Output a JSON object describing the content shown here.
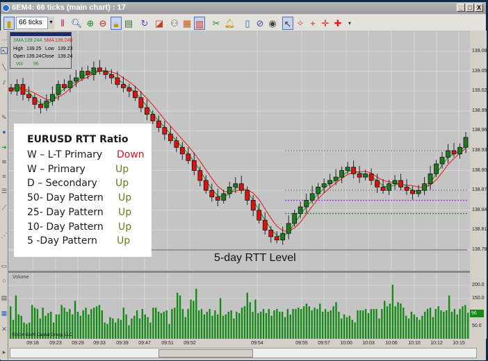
{
  "window": {
    "title": "6EM4: 66 ticks (main chart) : 17",
    "minimize": "_",
    "maximize": "□",
    "close": "X"
  },
  "toolbar": {
    "interval": "66 ticks"
  },
  "info": {
    "sma1_label": "SMA",
    "sma1": "139.244",
    "sma2_label": "SMA",
    "sma2": "139.248",
    "high_label": "High",
    "high": "139.25",
    "low_label": "Low",
    "low": "139.23",
    "open_label": "Open",
    "open": "139.24",
    "close_label": "Close",
    "close": "139.24",
    "vol_label": "Vol",
    "vol": "96"
  },
  "rtt": {
    "title": "EURUSD   RTT Ratio",
    "rows": [
      {
        "label": "W – L-T Primary",
        "value": "Down"
      },
      {
        "label": "W – Primary",
        "value": "Up"
      },
      {
        "label": "D – Secondary",
        "value": "Up"
      },
      {
        "label": "50- Day Pattern",
        "value": "Up"
      },
      {
        "label": "25- Day  Pattern",
        "value": "Up"
      },
      {
        "label": "10- Day Pattern",
        "value": "Up"
      },
      {
        "label": " 5  -Day Pattern",
        "value": "Up"
      }
    ]
  },
  "annotation": "5-day RTT Level",
  "price_axis": [
    "139.08",
    "139.05",
    "139.02",
    "138.99",
    "138.96",
    "138.93",
    "138.90",
    "138.87",
    "138.84",
    "138.81",
    "138.78"
  ],
  "volume_panel": {
    "title": "Volume",
    "axis": [
      "200.0",
      "150.0",
      "50.0"
    ],
    "current": "96",
    "copyright": "©2014 GAIN Capital Group, LLC"
  },
  "time_axis": [
    "09:18",
    "09:23",
    "09:29",
    "09:33",
    "09:39",
    "09:47",
    "09:51",
    "09:52",
    "09:54",
    "09:55",
    "09:57",
    "10:00",
    "10:03",
    "10:06",
    "10:10",
    "10:12",
    "10:15"
  ],
  "colors": {
    "up": "#1e7a1e",
    "down": "#e01010",
    "sma_fast": "#2e9a2e",
    "sma_slow": "#e03030",
    "support": "#9933cc",
    "level": "#2a8a2a"
  },
  "chart_data": {
    "type": "candlestick",
    "closes": [
      139.02,
      139.03,
      139.015,
      139.01,
      139.0,
      138.995,
      139.005,
      139.015,
      139.03,
      139.025,
      139.035,
      139.04,
      139.05,
      139.045,
      139.055,
      139.05,
      139.045,
      139.04,
      139.03,
      139.025,
      139.02,
      139.01,
      138.995,
      138.985,
      138.975,
      138.965,
      138.955,
      138.945,
      138.935,
      138.925,
      138.915,
      138.9,
      138.885,
      138.87,
      138.86,
      138.855,
      138.865,
      138.875,
      138.88,
      138.87,
      138.855,
      138.84,
      138.825,
      138.81,
      138.8,
      138.795,
      138.805,
      138.82,
      138.835,
      138.845,
      138.855,
      138.865,
      138.875,
      138.88,
      138.885,
      138.89,
      138.9,
      138.905,
      138.895,
      138.89,
      138.895,
      138.885,
      138.875,
      138.87,
      138.88,
      138.885,
      138.875,
      138.87,
      138.865,
      138.87,
      138.88,
      138.895,
      138.91,
      138.92,
      138.93,
      138.925,
      138.935,
      138.95
    ],
    "levels": [
      138.93,
      138.87,
      138.855,
      138.835,
      138.78
    ],
    "volume": [
      120,
      70,
      160,
      90,
      85,
      60,
      55,
      60,
      125,
      115,
      110,
      75,
      115,
      85,
      95,
      100,
      60,
      90,
      90,
      125,
      115,
      100,
      110,
      90,
      140,
      100,
      85,
      105,
      115,
      90,
      110,
      115,
      120,
      125,
      105,
      60,
      55,
      80,
      75,
      60,
      75,
      70,
      115,
      90,
      50,
      75,
      85,
      105,
      75,
      110,
      90,
      80,
      60,
      115,
      115,
      100,
      95,
      100,
      105,
      55,
      110,
      115,
      170,
      160,
      110,
      80,
      110,
      145,
      140,
      185,
      105,
      110,
      90,
      100,
      110,
      85,
      105,
      90,
      150,
      85,
      90,
      100,
      105,
      75,
      100,
      95,
      115,
      120,
      170,
      135,
      100,
      145,
      95,
      100,
      110,
      95,
      110,
      85,
      105,
      110,
      100,
      100,
      80,
      110,
      90,
      110,
      110,
      115,
      110,
      120,
      130,
      120,
      105,
      115,
      110,
      130,
      100,
      110,
      100,
      105,
      120,
      135,
      100,
      75,
      90,
      80,
      85,
      70,
      60,
      105,
      105,
      105,
      110,
      95,
      110,
      110,
      110,
      75,
      110,
      140,
      120,
      130,
      200,
      120,
      135,
      130,
      115,
      85,
      75,
      100,
      90,
      80,
      70,
      85,
      100,
      110,
      115,
      80,
      110,
      120,
      105,
      100,
      105,
      160,
      100,
      110,
      90,
      110,
      120,
      125,
      96
    ]
  }
}
